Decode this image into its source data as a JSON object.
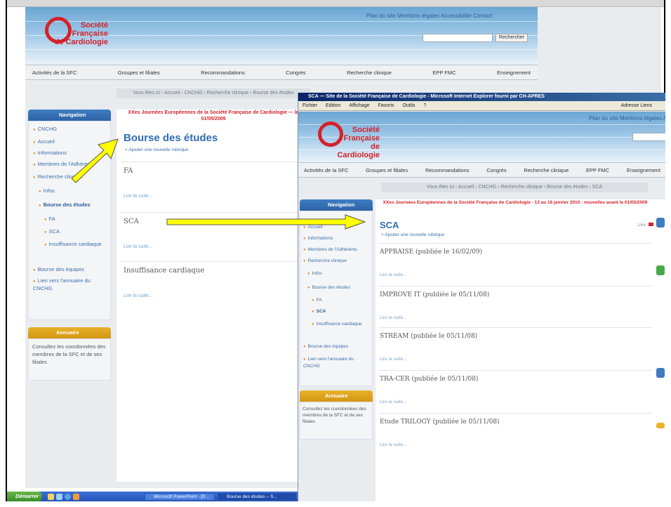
{
  "brand": {
    "logo_line1": "Société",
    "logo_line2": "Française",
    "logo_line3": "de Cardiologie"
  },
  "top_links": "Plan du site  Mentions légales  Accessibilité  Contact",
  "search_button": "Rechercher",
  "nav": [
    "Activités de la SFC",
    "Groupes et filiales",
    "Recommandations",
    "Congrès",
    "Recherche clinique",
    "EPP FMC",
    "Enseignement"
  ],
  "window1": {
    "breadcrumb": "Vous êtes ici : Accueil › CNCHG › Recherche clinique › Bourse des études",
    "alert": "XXes Journées Européennes de la Société Française de Cardiologie — le 01/05/2009",
    "page_title": "Bourse des études",
    "add_link": "+ Ajouter une nouvelle rubrique",
    "entries": [
      {
        "title": "FA",
        "more": "Lire la suite..."
      },
      {
        "title": "SCA",
        "more": "Lire la suite..."
      },
      {
        "title": "Insuffisance cardiaque",
        "more": "Lire la suite..."
      }
    ],
    "sidebar_header": "Navigation",
    "sidebar_items": [
      "CNCHG",
      "Accueil",
      "Informations",
      "Membres de l'Adhérents",
      "Recherche clinique",
      "Infos",
      "Bourse des études",
      "FA",
      "SCA",
      "Insuffisance cardiaque",
      "Bourse des équipes",
      "Lien vers l'annuaire du CNCHG"
    ],
    "panel_header": "Annuaire",
    "panel_text": "Consultez les coordonnées des membres de la SFC et de ses filiales"
  },
  "window2": {
    "title": "SCA — Site de la Société Française de Cardiologie - Microsoft Internet Explorer fourni par CH-APRES",
    "menu": [
      "Fichier",
      "Edition",
      "Affichage",
      "Favoris",
      "Outils",
      "?"
    ],
    "menu_right": "Adresse  Liens",
    "breadcrumb": "Vous êtes ici : Accueil › CNCHG › Recherche clinique › Bourse des études › SCA",
    "alert": "XXes Journées Européennes de la Société Française de Cardiologie - 13 au 16 janvier 2010 : nouvelles avant le 01/05/2009",
    "page_title": "SCA",
    "add_link": "+ Ajouter une nouvelle rubrique",
    "edit_label": "Lire",
    "entries": [
      {
        "title": "APPRAISE (publiée le 16/02/09)",
        "more": "Lire la suite..."
      },
      {
        "title": "IMPROVE IT (publiée le 05/11/08)",
        "more": "Lire la suite..."
      },
      {
        "title": "STREAM (publiée le 05/11/08)",
        "more": "Lire la suite..."
      },
      {
        "title": "TRA-CER (publiée le 05/11/08)",
        "more": "Lire la suite..."
      },
      {
        "title": "Etude TRILOGY (publiée le 05/11/08)",
        "more": "Lire la suite..."
      }
    ],
    "sidebar_header": "Navigation",
    "sidebar_items": [
      "Accueil",
      "Informations",
      "Membres de l'Adhérents",
      "Recherche clinique",
      "Infos",
      "Bourse des études",
      "FA",
      "SCA",
      "Insuffisance cardiaque",
      "Bourse des équipes",
      "Lien vers l'annuaire du CNCHG"
    ],
    "panel_header": "Annuaire",
    "panel_text": "Consultez les coordonnées des membres de la SFC et de ses filiales"
  },
  "taskbar": {
    "start": "Démarrer",
    "items": [
      "Microsoft PowerPoint - [D...",
      "Bourse des études -- S..."
    ]
  },
  "colors": {
    "accent_red": "#d4222a",
    "title_blue": "#2f6db1",
    "arrow_yellow": "#ffff00"
  }
}
